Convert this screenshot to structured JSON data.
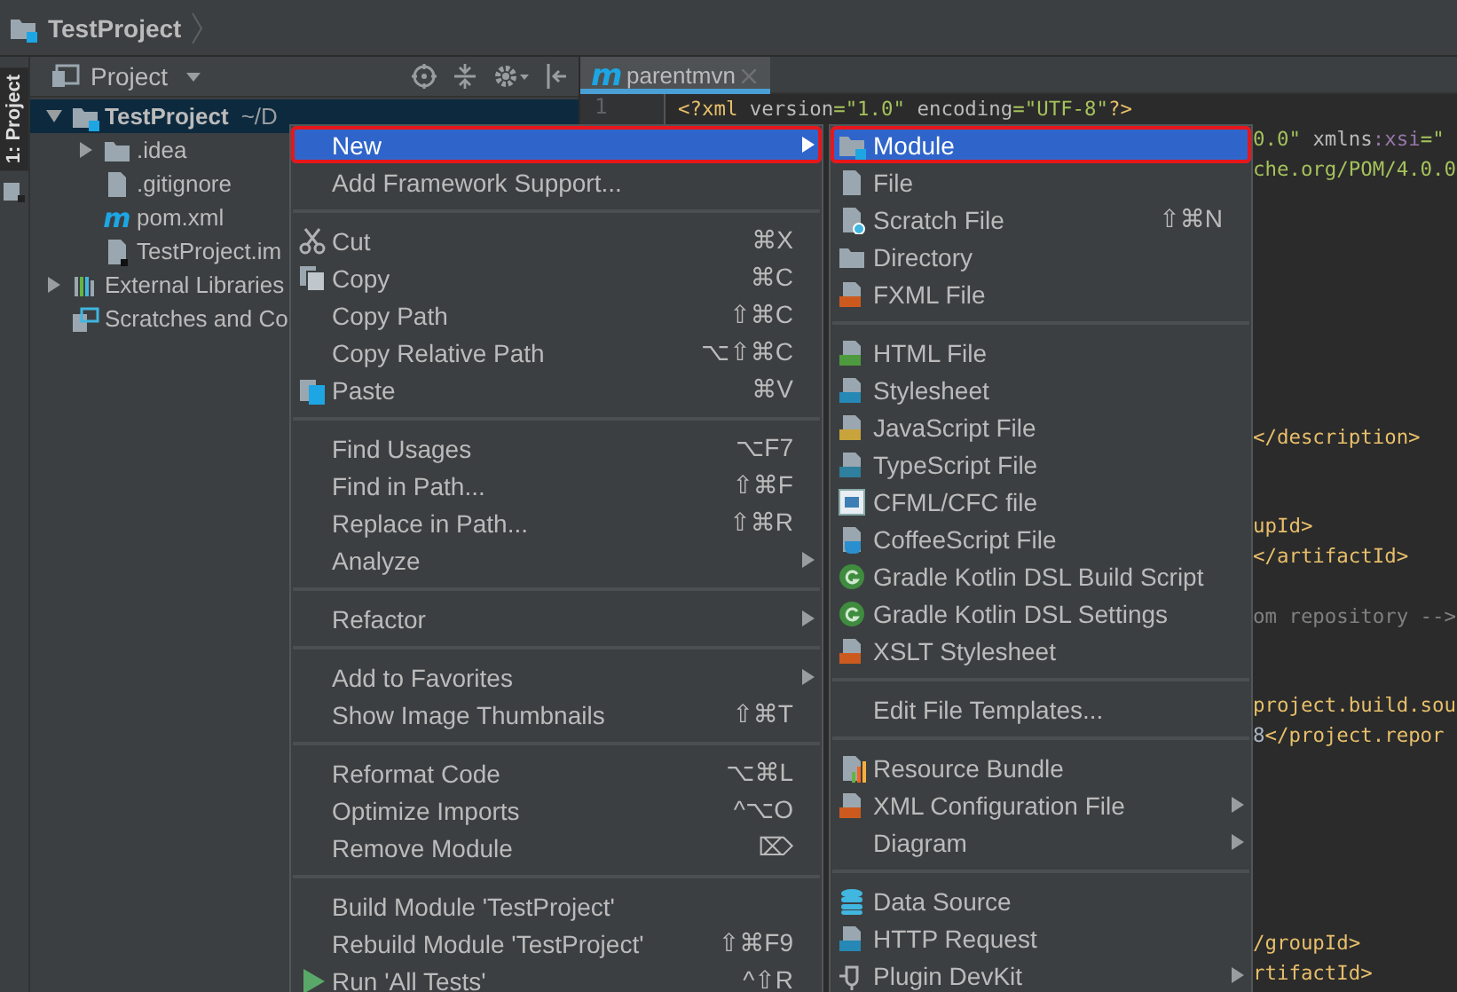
{
  "window": {
    "title": "TestProject"
  },
  "tool_stripe": [
    {
      "label": "1: Project",
      "selected": true
    }
  ],
  "project_panel": {
    "title": "Project",
    "tree": [
      {
        "label": "TestProject",
        "path": "~/D",
        "kind": "module",
        "expanded": true,
        "selected": true,
        "children": [
          {
            "label": ".idea",
            "kind": "folder",
            "expanded": false,
            "selected": false
          },
          {
            "label": ".gitignore",
            "kind": "file",
            "selected": false
          },
          {
            "label": "pom.xml",
            "kind": "maven",
            "icon_text": "m",
            "selected": false
          },
          {
            "label": "TestProject.im",
            "kind": "iml",
            "selected": false
          }
        ]
      },
      {
        "label": "External Libraries",
        "kind": "libraries",
        "expanded": false,
        "selected": false
      },
      {
        "label": "Scratches and Co",
        "kind": "scratches",
        "selected": false
      }
    ]
  },
  "editor": {
    "tabs": [
      {
        "label": "parentmvn",
        "icon_text": "m",
        "selected": true
      }
    ],
    "lines": [
      {
        "number": "1",
        "clipped": false,
        "segments": [
          {
            "text": "<?xml ",
            "kind": "tag"
          },
          {
            "text": "version",
            "kind": "attr"
          },
          {
            "text": "=\"1.0\" ",
            "kind": "value"
          },
          {
            "text": "encoding",
            "kind": "attr"
          },
          {
            "text": "=\"UTF-8\"",
            "kind": "value"
          },
          {
            "text": "?>",
            "kind": "tag"
          }
        ]
      },
      {
        "clipped": true,
        "segments": [
          {
            "text": "0.0\"",
            "kind": "value"
          },
          {
            "text": " xmlns",
            "kind": "attr"
          },
          {
            "text": ":xsi",
            "kind": "ns"
          },
          {
            "text": "=\"",
            "kind": "value"
          }
        ]
      },
      {
        "clipped": true,
        "segments": [
          {
            "text": "che.org/POM/4.0.0",
            "kind": "value"
          }
        ]
      },
      {
        "clipped": true,
        "segments": [
          {
            "text": "</description>",
            "kind": "tag"
          }
        ]
      },
      {
        "clipped": true,
        "segments": [
          {
            "text": "upId>",
            "kind": "tag"
          }
        ]
      },
      {
        "clipped": true,
        "segments": [
          {
            "text": "</artifactId>",
            "kind": "tag"
          }
        ]
      },
      {
        "clipped": true,
        "segments": [
          {
            "text": "om repository -->",
            "kind": "comment"
          }
        ]
      },
      {
        "clipped": true,
        "segments": [
          {
            "text": "project.build.sou",
            "kind": "tag"
          }
        ]
      },
      {
        "clipped": true,
        "segments": [
          {
            "text": "8",
            "kind": "text"
          },
          {
            "text": "</project.repor",
            "kind": "tag"
          }
        ]
      },
      {
        "clipped": true,
        "segments": [
          {
            "text": "/groupId>",
            "kind": "tag"
          }
        ]
      },
      {
        "clipped": true,
        "segments": [
          {
            "text": "rtifactId>",
            "kind": "tag"
          }
        ]
      }
    ]
  },
  "context_menu": {
    "groups": [
      [
        {
          "label": "New",
          "submenu": true,
          "selected": true,
          "highlighted": true
        },
        {
          "label": "Add Framework Support...",
          "submenu": false,
          "selected": false,
          "highlighted": false
        }
      ],
      [
        {
          "label": "Cut",
          "shortcut": "⌘X",
          "kind": "cut",
          "submenu": false,
          "selected": false,
          "highlighted": false
        },
        {
          "label": "Copy",
          "shortcut": "⌘C",
          "kind": "copy",
          "submenu": false,
          "selected": false,
          "highlighted": false
        },
        {
          "label": "Copy Path",
          "shortcut": "⇧⌘C",
          "submenu": false,
          "selected": false,
          "highlighted": false
        },
        {
          "label": "Copy Relative Path",
          "shortcut": "⌥⇧⌘C",
          "submenu": false,
          "selected": false,
          "highlighted": false
        },
        {
          "label": "Paste",
          "shortcut": "⌘V",
          "kind": "paste",
          "submenu": false,
          "selected": false,
          "highlighted": false
        }
      ],
      [
        {
          "label": "Find Usages",
          "shortcut": "⌥F7",
          "submenu": false,
          "selected": false,
          "highlighted": false
        },
        {
          "label": "Find in Path...",
          "shortcut": "⇧⌘F",
          "submenu": false,
          "selected": false,
          "highlighted": false
        },
        {
          "label": "Replace in Path...",
          "shortcut": "⇧⌘R",
          "submenu": false,
          "selected": false,
          "highlighted": false
        },
        {
          "label": "Analyze",
          "submenu": true,
          "selected": false,
          "highlighted": false
        }
      ],
      [
        {
          "label": "Refactor",
          "submenu": true,
          "selected": false,
          "highlighted": false
        }
      ],
      [
        {
          "label": "Add to Favorites",
          "submenu": true,
          "selected": false,
          "highlighted": false
        },
        {
          "label": "Show Image Thumbnails",
          "shortcut": "⇧⌘T",
          "submenu": false,
          "selected": false,
          "highlighted": false
        }
      ],
      [
        {
          "label": "Reformat Code",
          "shortcut": "⌥⌘L",
          "submenu": false,
          "selected": false,
          "highlighted": false
        },
        {
          "label": "Optimize Imports",
          "shortcut": "^⌥O",
          "submenu": false,
          "selected": false,
          "highlighted": false
        },
        {
          "label": "Remove Module",
          "shortcut": "⌦",
          "submenu": false,
          "selected": false,
          "highlighted": false
        }
      ],
      [
        {
          "label": "Build Module 'TestProject'",
          "submenu": false,
          "selected": false,
          "highlighted": false
        },
        {
          "label": "Rebuild Module 'TestProject'",
          "shortcut": "⇧⌘F9",
          "submenu": false,
          "selected": false,
          "highlighted": false
        },
        {
          "label": "Run 'All Tests'",
          "shortcut": "^⇧R",
          "kind": "run",
          "submenu": false,
          "selected": false,
          "highlighted": false
        }
      ]
    ]
  },
  "submenu": {
    "groups": [
      [
        {
          "label": "Module",
          "kind": "module",
          "submenu": false,
          "selected": true,
          "highlighted": true
        },
        {
          "label": "File",
          "kind": "file",
          "submenu": false,
          "selected": false,
          "highlighted": false
        },
        {
          "label": "Scratch File",
          "shortcut": "⇧⌘N",
          "kind": "scratch",
          "submenu": false,
          "selected": false,
          "highlighted": false
        },
        {
          "label": "Directory",
          "kind": "folder",
          "submenu": false,
          "selected": false,
          "highlighted": false
        },
        {
          "label": "FXML File",
          "kind": "fxml",
          "submenu": false,
          "selected": false,
          "highlighted": false
        }
      ],
      [
        {
          "label": "HTML File",
          "kind": "html",
          "submenu": false,
          "selected": false,
          "highlighted": false
        },
        {
          "label": "Stylesheet",
          "kind": "css",
          "submenu": false,
          "selected": false,
          "highlighted": false
        },
        {
          "label": "JavaScript File",
          "kind": "js",
          "submenu": false,
          "selected": false,
          "highlighted": false
        },
        {
          "label": "TypeScript File",
          "kind": "ts",
          "submenu": false,
          "selected": false,
          "highlighted": false
        },
        {
          "label": "CFML/CFC file",
          "kind": "cfml",
          "submenu": false,
          "selected": false,
          "highlighted": false
        },
        {
          "label": "CoffeeScript File",
          "kind": "coffee",
          "submenu": false,
          "selected": false,
          "highlighted": false
        },
        {
          "label": "Gradle Kotlin DSL Build Script",
          "kind": "gradle",
          "submenu": false,
          "selected": false,
          "highlighted": false
        },
        {
          "label": "Gradle Kotlin DSL Settings",
          "kind": "gradle",
          "submenu": false,
          "selected": false,
          "highlighted": false
        },
        {
          "label": "XSLT Stylesheet",
          "kind": "xslt",
          "submenu": false,
          "selected": false,
          "highlighted": false
        }
      ],
      [
        {
          "label": "Edit File Templates...",
          "submenu": false,
          "selected": false,
          "highlighted": false
        }
      ],
      [
        {
          "label": "Resource Bundle",
          "kind": "bundle",
          "submenu": false,
          "selected": false,
          "highlighted": false
        },
        {
          "label": "XML Configuration File",
          "kind": "xslt",
          "submenu": true,
          "selected": false,
          "highlighted": false
        },
        {
          "label": "Diagram",
          "submenu": true,
          "selected": false,
          "highlighted": false
        }
      ],
      [
        {
          "label": "Data Source",
          "kind": "database",
          "submenu": false,
          "selected": false,
          "highlighted": false
        },
        {
          "label": "HTTP Request",
          "kind": "http",
          "submenu": false,
          "selected": false,
          "highlighted": false
        },
        {
          "label": "Plugin DevKit",
          "kind": "plugin",
          "submenu": true,
          "selected": false,
          "highlighted": false
        }
      ]
    ]
  }
}
